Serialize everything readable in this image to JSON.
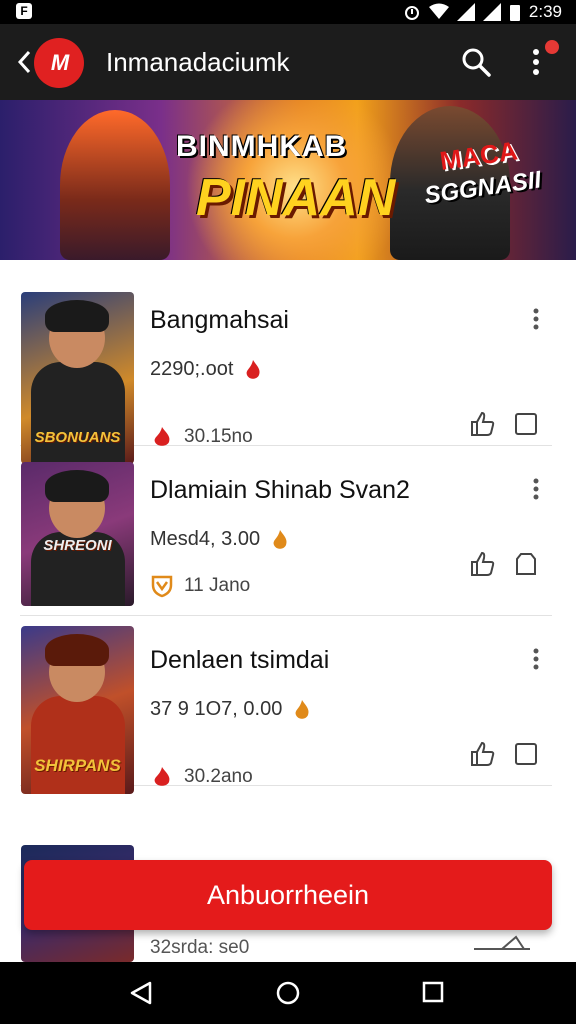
{
  "status_bar": {
    "left_icon_glyph": "F",
    "time": "2:39"
  },
  "app_bar": {
    "logo_text": "M",
    "title": "Inmanadaciumk"
  },
  "banner": {
    "headline_1": "BINMHKAB",
    "headline_2": "PINAAN",
    "badge_1": "MACA",
    "badge_2": "SGGNASII"
  },
  "items": [
    {
      "name": "Bangmahsai",
      "meta": "2290;.oot",
      "stat": "30.15no",
      "thumb_caption": "SBONUANS",
      "thumb_bg": "#2a3e7a",
      "stat_icon": "flame-icon"
    },
    {
      "name": "Dlamiain Shinab Svan2",
      "meta": "Mesd4, 3.00",
      "stat": "11 Jano",
      "thumb_caption": "SHREONI",
      "thumb_bg": "#5a2a6a",
      "stat_icon": "shield-icon"
    },
    {
      "name": "Denlaen tsimdai",
      "meta": "37 9 1O7,  0.00",
      "stat": "30.2ano",
      "thumb_caption": "SHIRPANS",
      "thumb_bg": "#7a3a2a",
      "stat_icon": "flame-icon"
    }
  ],
  "peek_item": {
    "meta": "32srda: se0"
  },
  "fab": {
    "label": "Anbuorrheein"
  },
  "colors": {
    "accent": "#e41b1b",
    "appbar": "#1c1c1c"
  }
}
